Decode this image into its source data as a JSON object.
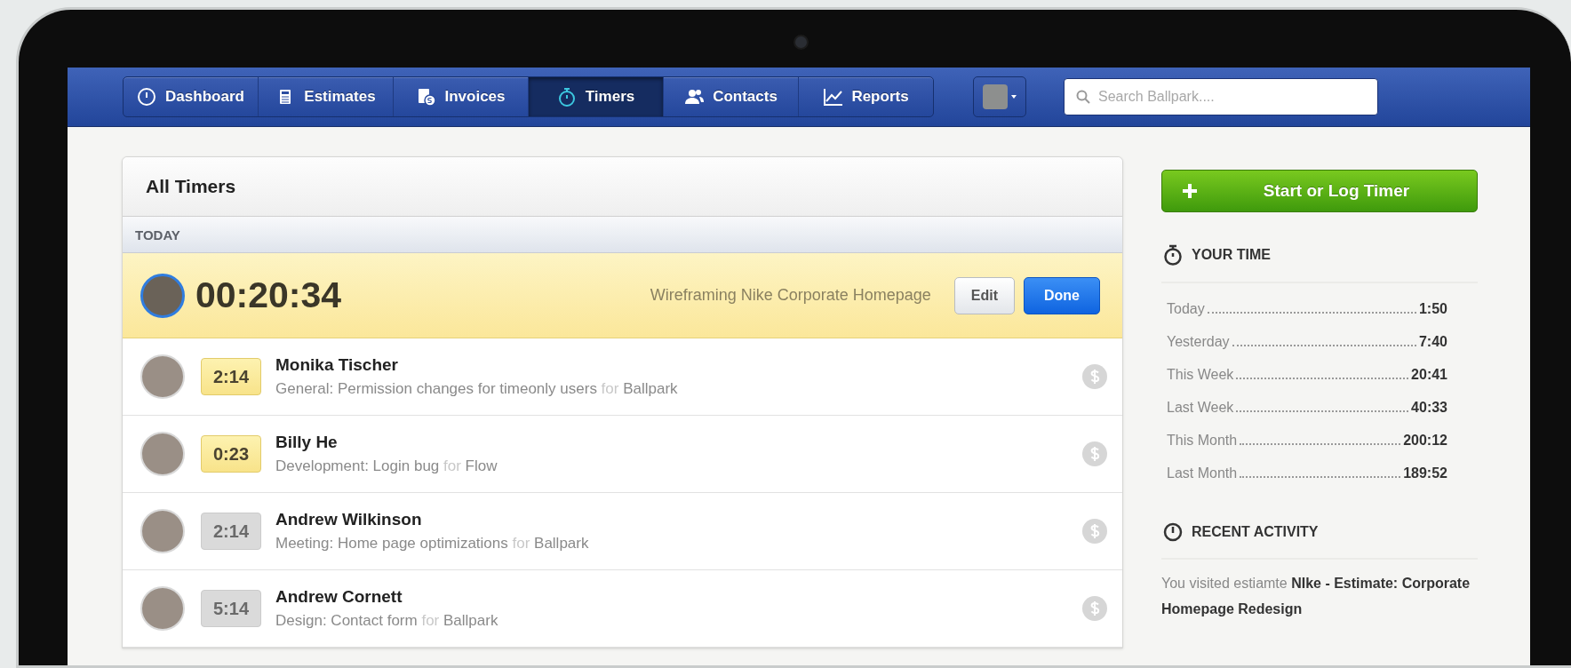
{
  "nav": {
    "tabs": [
      {
        "label": "Dashboard",
        "selected": false
      },
      {
        "label": "Estimates",
        "selected": false
      },
      {
        "label": "Invoices",
        "selected": false
      },
      {
        "label": "Timers",
        "selected": true
      },
      {
        "label": "Contacts",
        "selected": false
      },
      {
        "label": "Reports",
        "selected": false
      }
    ]
  },
  "search": {
    "placeholder": "Search Ballpark...."
  },
  "timers": {
    "title": "All Timers",
    "group": "TODAY",
    "running": {
      "time": "00:20:34",
      "task": "Wireframing Nike Corporate Homepage",
      "buttons": [
        {
          "label": "Edit",
          "kind": "secondary"
        },
        {
          "label": "Done",
          "kind": "primary"
        }
      ]
    },
    "entries": [
      {
        "name": "Monika Tischer",
        "duration": "2:14",
        "highlighted": true,
        "task": "General: Permission changes for timeonly users",
        "connector": "for",
        "client": "Ballpark"
      },
      {
        "name": "Billy He",
        "duration": "0:23",
        "highlighted": true,
        "task": "Development: Login bug",
        "connector": "for",
        "client": "Flow"
      },
      {
        "name": "Andrew Wilkinson",
        "duration": "2:14",
        "highlighted": false,
        "task": "Meeting: Home page optimizations",
        "connector": "for",
        "client": "Ballpark"
      },
      {
        "name": "Andrew Cornett",
        "duration": "5:14",
        "highlighted": false,
        "task": "Design: Contact form",
        "connector": "for",
        "client": "Ballpark"
      }
    ]
  },
  "sidebar": {
    "button": "Start or Log Timer",
    "your_time": {
      "title": "YOUR TIME",
      "rows": [
        {
          "label": "Today",
          "value": "1:50"
        },
        {
          "label": "Yesterday",
          "value": "7:40"
        },
        {
          "label": "This Week",
          "value": "20:41"
        },
        {
          "label": "Last Week",
          "value": "40:33"
        },
        {
          "label": "This Month",
          "value": "200:12"
        },
        {
          "label": "Last Month",
          "value": "189:52"
        }
      ]
    },
    "recent": {
      "title": "RECENT ACTIVITY",
      "text": "You visited estiamte **NIke - Estimate: Corporate Homepage Redesign**"
    }
  }
}
